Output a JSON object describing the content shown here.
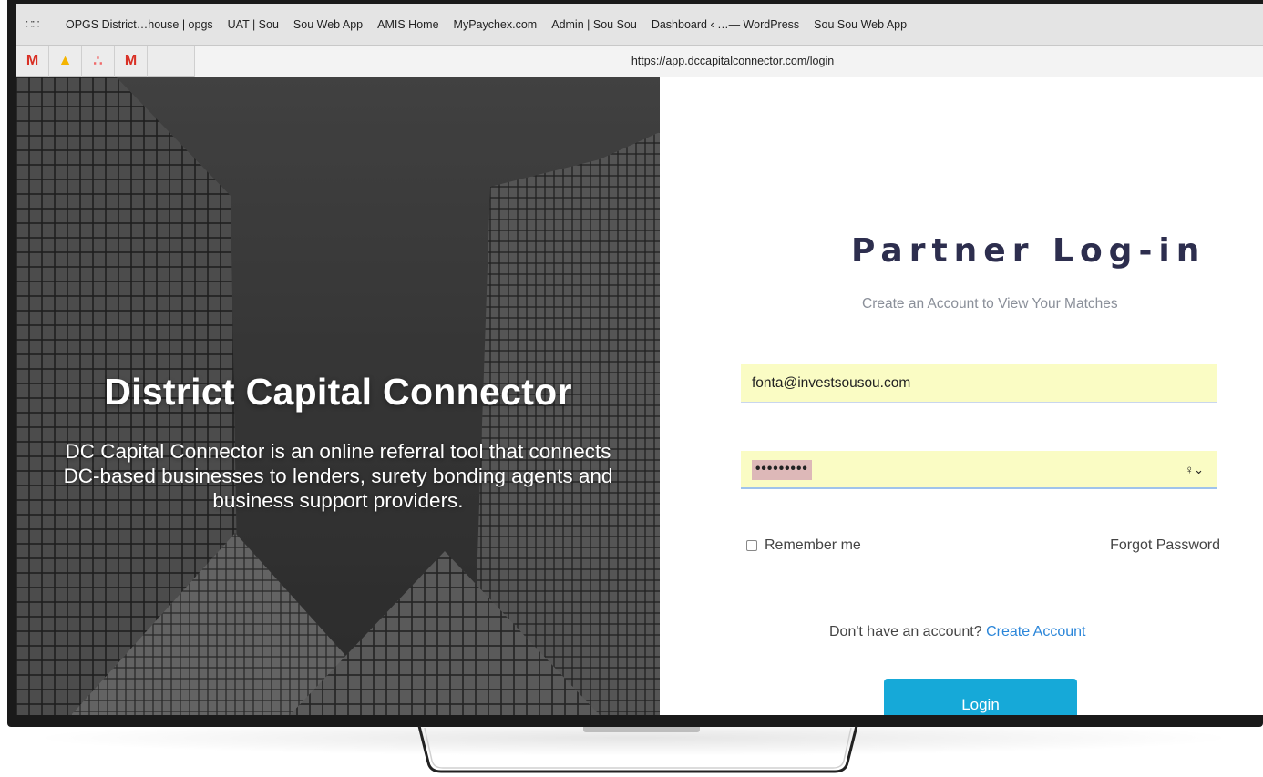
{
  "browser": {
    "bookmarks": [
      "OPGS District…house | opgs",
      "UAT | Sou",
      "Sou Web App",
      "AMIS Home",
      "MyPaychex.com",
      "Admin | Sou Sou",
      "Dashboard ‹ …— WordPress",
      "Sou Sou Web App"
    ],
    "apps_icon": "∷∷",
    "pinned_tabs": [
      {
        "icon": "gmail-icon",
        "glyph": "M"
      },
      {
        "icon": "google-drive-icon",
        "glyph": "▲"
      },
      {
        "icon": "asana-icon",
        "glyph": "∴"
      },
      {
        "icon": "gmail-icon",
        "glyph": "M"
      }
    ],
    "url": "https://app.dccapitalconnector.com/login"
  },
  "hero": {
    "title": "District Capital Connector",
    "description": "DC Capital Connector is an online referral tool that connects DC-based businesses to lenders, surety bonding agents and business support providers."
  },
  "login": {
    "title": "Partner Log-in",
    "subtitle": "Create an Account to View Your Matches",
    "email_value": "fonta@investsousou.com",
    "password_mask": "•••••••••",
    "key_icon_glyph": "♀⌄",
    "remember_label": "Remember me",
    "forgot_label": "Forgot Password",
    "no_account_text": "Don't have an account?",
    "create_account_label": "Create Account",
    "login_button_label": "Login"
  },
  "colors": {
    "title": "#2d2e4e",
    "link": "#2b86d9",
    "button": "#16a9d8",
    "autofill": "#fafcc4"
  }
}
